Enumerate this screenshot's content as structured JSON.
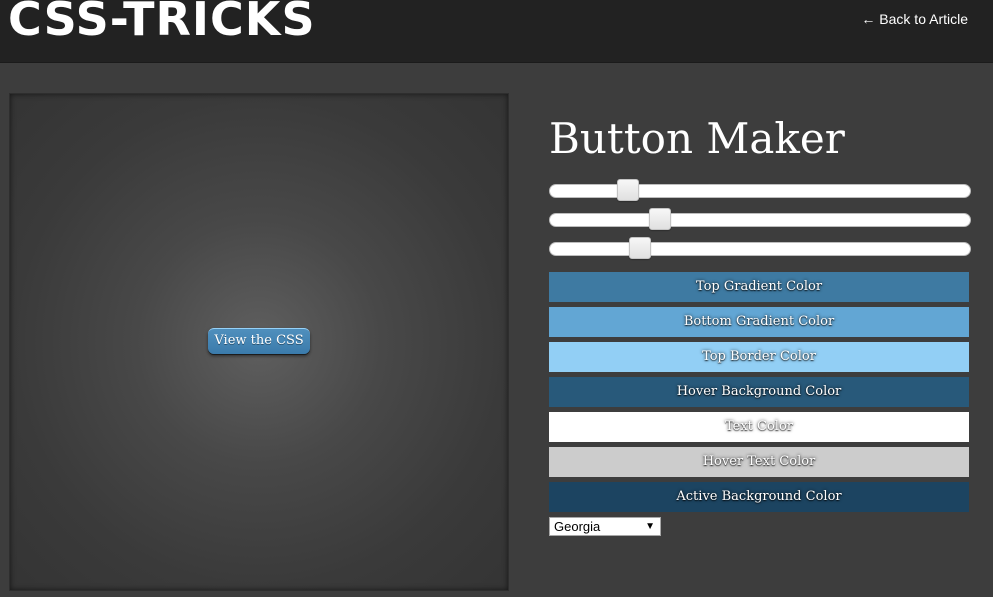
{
  "header": {
    "logo": "CSS-TRICKS",
    "back_link": "← Back to Article"
  },
  "preview": {
    "button_label": "View the CSS"
  },
  "panel": {
    "title": "Button Maker",
    "sliders": [
      {
        "name": "slider-1",
        "value": 0.17
      },
      {
        "name": "slider-2",
        "value": 0.25
      },
      {
        "name": "slider-3",
        "value": 0.2
      }
    ],
    "color_buttons": [
      {
        "label": "Top Gradient Color",
        "color": "#3e7aa2"
      },
      {
        "label": "Bottom Gradient Color",
        "color": "#62a6d4"
      },
      {
        "label": "Top Border Color",
        "color": "#92cff5"
      },
      {
        "label": "Hover Background Color",
        "color": "#28597a"
      },
      {
        "label": "Text Color",
        "color": "#ffffff"
      },
      {
        "label": "Hover Text Color",
        "color": "#cccccc"
      },
      {
        "label": "Active Background Color",
        "color": "#1c4461"
      }
    ],
    "font_select": {
      "selected": "Georgia",
      "arrow": "▼"
    }
  }
}
